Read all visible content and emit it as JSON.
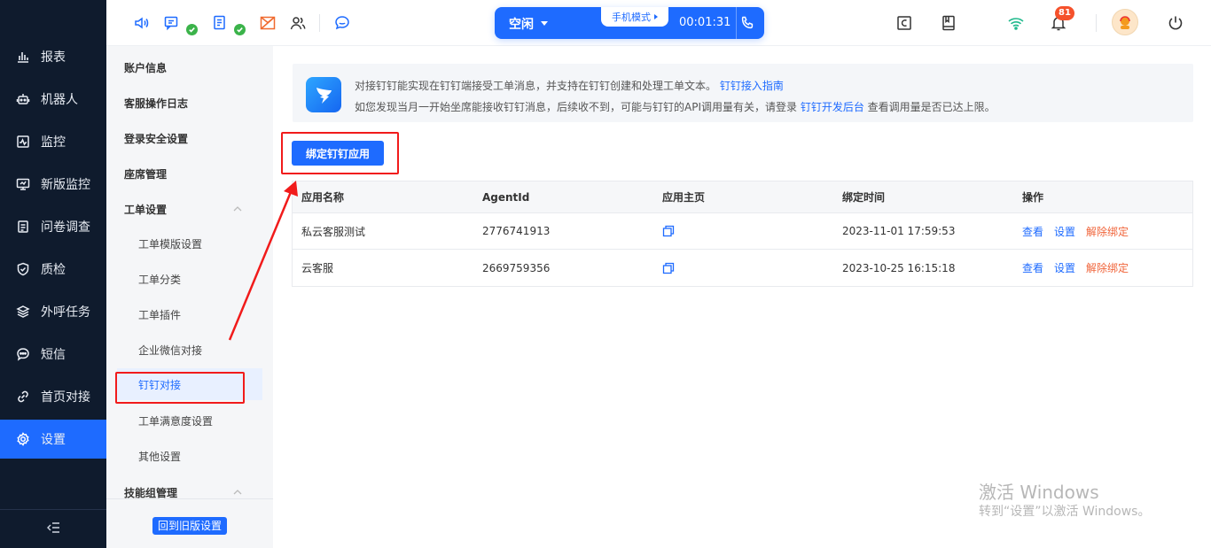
{
  "leftnav": {
    "items": [
      {
        "label": "报表",
        "icon": "bar-chart-icon"
      },
      {
        "label": "机器人",
        "icon": "robot-icon"
      },
      {
        "label": "监控",
        "icon": "monitor-pulse-icon"
      },
      {
        "label": "新版监控",
        "icon": "desktop-monitor-icon"
      },
      {
        "label": "问卷调查",
        "icon": "survey-icon"
      },
      {
        "label": "质检",
        "icon": "shield-check-icon"
      },
      {
        "label": "外呼任务",
        "icon": "layers-icon"
      },
      {
        "label": "短信",
        "icon": "chat-bubble-icon"
      },
      {
        "label": "首页对接",
        "icon": "link-icon"
      },
      {
        "label": "设置",
        "icon": "gear-icon"
      }
    ],
    "active": "设置",
    "collapse_icon": "collapse-menu-icon"
  },
  "header": {
    "status": {
      "label": "空闲",
      "mode": "手机模式",
      "timer": "00:01:31"
    },
    "notification_count": "81"
  },
  "subnav": {
    "items": [
      {
        "label": "账户信息",
        "type": "group"
      },
      {
        "label": "客服操作日志",
        "type": "group"
      },
      {
        "label": "登录安全设置",
        "type": "group"
      },
      {
        "label": "座席管理",
        "type": "group"
      },
      {
        "label": "工单设置",
        "type": "group",
        "expanded": true
      },
      {
        "label": "工单模版设置",
        "type": "child"
      },
      {
        "label": "工单分类",
        "type": "child"
      },
      {
        "label": "工单插件",
        "type": "child"
      },
      {
        "label": "企业微信对接",
        "type": "child"
      },
      {
        "label": "钉钉对接",
        "type": "child",
        "active": true
      },
      {
        "label": "工单满意度设置",
        "type": "child"
      },
      {
        "label": "其他设置",
        "type": "child"
      },
      {
        "label": "技能组管理",
        "type": "group",
        "expanded": true
      }
    ],
    "legacy_button": "回到旧版设置"
  },
  "main": {
    "notice": {
      "line1_text": "对接钉钉能实现在钉钉端接受工单消息，并支持在钉钉创建和处理工单文本。",
      "line1_link": "钉钉接入指南",
      "line2_text_a": "如您发现当月一开始坐席能接收钉钉消息，后续收不到，可能与钉钉的API调用量有关，请登录",
      "line2_link": "钉钉开发后台",
      "line2_text_b": "查看调用量是否已达上限。"
    },
    "bind_button": "绑定钉钉应用",
    "table": {
      "headers": [
        "应用名称",
        "AgentId",
        "应用主页",
        "绑定时间",
        "操作"
      ],
      "rows": [
        {
          "name": "私云客服测试",
          "agent_id": "2776741913",
          "time": "2023-11-01 17:59:53"
        },
        {
          "name": "云客服",
          "agent_id": "2669759356",
          "time": "2023-10-25 16:15:18"
        }
      ],
      "actions": {
        "view": "查看",
        "settings": "设置",
        "unbind": "解除绑定"
      }
    }
  },
  "watermark": {
    "line1": "激活 Windows",
    "line2": "转到“设置”以激活 Windows。"
  },
  "colors": {
    "primary": "#1e6bff",
    "sidebar_bg": "#0f1b2d",
    "annotation_red": "#f11b1b",
    "unbind": "#f0643a",
    "badge": "#f5512b",
    "check_green": "#3bb34a"
  }
}
